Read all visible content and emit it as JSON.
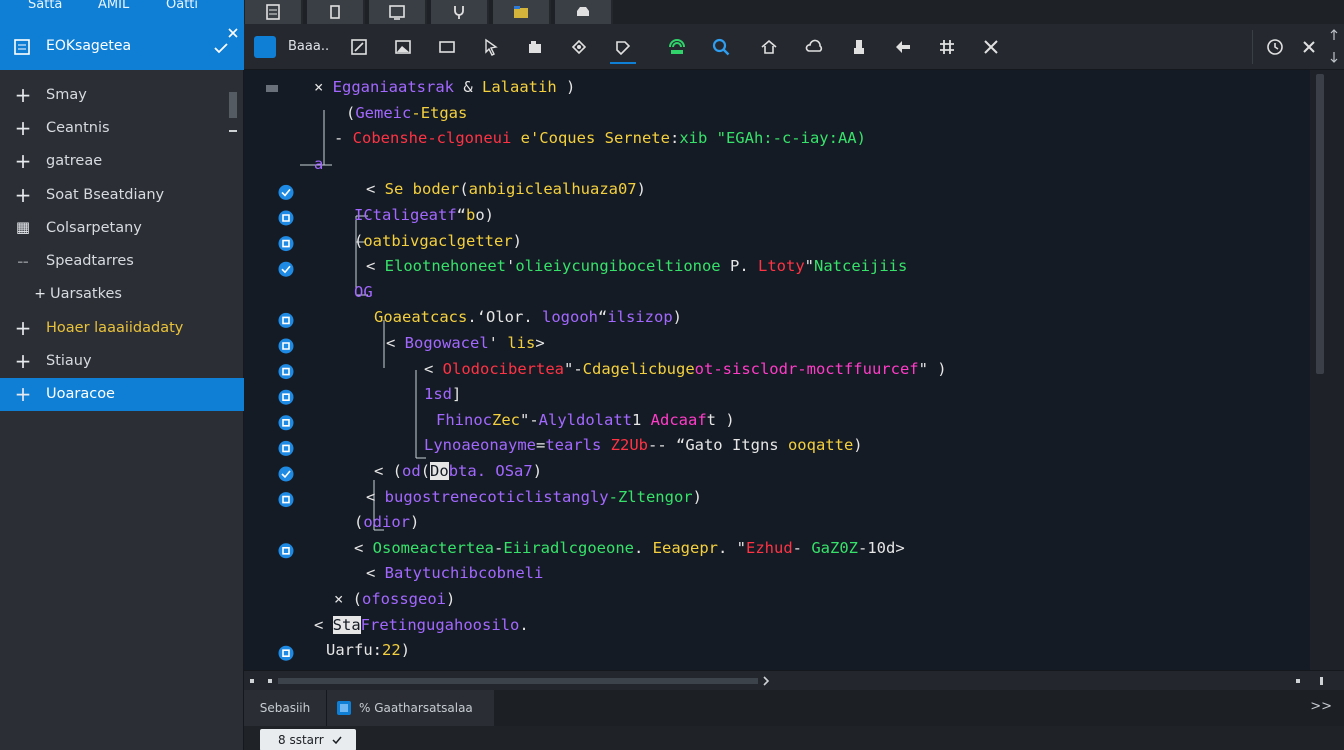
{
  "app": {
    "top_menu": [
      "Satta",
      "AMIL",
      "Oatti"
    ],
    "sidebar_title": "EOKsagetea",
    "editor_tab": "Baaa..",
    "bottom_tabs": [
      "Sebasiih",
      "% Gaatharsatsalaa"
    ],
    "bottom_status": "8 sstarr",
    "bottom_more": ">>"
  },
  "sidebar": {
    "items": [
      {
        "label": "Smay",
        "icon": "plus"
      },
      {
        "label": "Ceantnis",
        "icon": "plus"
      },
      {
        "label": "gatreae",
        "icon": "plus"
      },
      {
        "label": "Soat Bseatdiany",
        "icon": "plus"
      },
      {
        "label": "Colsarpetany",
        "icon": "grid"
      },
      {
        "label": "Speadtarres",
        "icon": "dash"
      },
      {
        "label": "Uarsatkes",
        "icon": "small-plus",
        "sub": true
      },
      {
        "label": "Hoaer laaaiidadaty",
        "icon": "plus",
        "highlight": true
      },
      {
        "label": "Stiauy",
        "icon": "plus"
      },
      {
        "label": "Uoaracoe",
        "icon": "plus",
        "active": true
      }
    ]
  },
  "colors": {
    "accent": "#0f7fd6",
    "code_bg": "#141b24",
    "purple": "#a368ff",
    "yellow": "#f4d03f",
    "red": "#ff3344",
    "green": "#37e26a",
    "magenta": "#ff3cc8",
    "white": "#e6e6e6",
    "cyan": "#36c8ff"
  },
  "code_lines": [
    {
      "marker": "",
      "guides": [],
      "indent": 0,
      "segs": [
        {
          "t": "× ",
          "c": "white"
        },
        {
          "t": "Egganiaatsrak ",
          "c": "purple"
        },
        {
          "t": "& ",
          "c": "white"
        },
        {
          "t": "Lalaatih",
          "c": "yellow"
        },
        {
          "t": " )",
          "c": "white"
        }
      ]
    },
    {
      "marker": "",
      "guides": [],
      "indent": 1,
      "segs": [
        {
          "t": "(",
          "c": "white"
        },
        {
          "t": "Gemeic",
          "c": "purple"
        },
        {
          "t": "-",
          "c": "yellow"
        },
        {
          "t": "Etgas",
          "c": "yellow"
        }
      ]
    },
    {
      "marker": "",
      "guides": [],
      "indent": 1,
      "segs": [
        {
          "t": "- ",
          "c": "white"
        },
        {
          "t": "Cobenshe-clgoneui",
          "c": "red"
        },
        {
          "t": " e'Coques ",
          "c": "yellow"
        },
        {
          "t": "Sernete",
          "c": "yellow"
        },
        {
          "t": ":",
          "c": "white"
        },
        {
          "t": "xib ",
          "c": "green"
        },
        {
          "t": "\"EGAh:-c-iay:AA)",
          "c": "green"
        }
      ]
    },
    {
      "marker": "",
      "guides": [],
      "indent": 0,
      "segs": [
        {
          "t": "  ",
          "c": "white"
        },
        {
          "t": "a",
          "c": "purple"
        }
      ]
    },
    {
      "marker": "check",
      "guides": [],
      "indent": 2,
      "segs": [
        {
          "t": "< ",
          "c": "white"
        },
        {
          "t": "Se boder",
          "c": "yellow"
        },
        {
          "t": "(",
          "c": "white"
        },
        {
          "t": "anbigiclealhuaza07",
          "c": "yellow"
        },
        {
          "t": ")",
          "c": "white"
        }
      ]
    },
    {
      "marker": "dot",
      "guides": [],
      "indent": 2,
      "segs": [
        {
          "t": "ICtaligeatf",
          "c": "purple"
        },
        {
          "t": "“",
          "c": "white"
        },
        {
          "t": "b",
          "c": "yellow"
        },
        {
          "t": "o)",
          "c": "white"
        }
      ]
    },
    {
      "marker": "dot",
      "guides": [],
      "indent": 2,
      "segs": [
        {
          "t": "(",
          "c": "white"
        },
        {
          "t": "oatbivgaclgetter",
          "c": "yellow"
        },
        {
          "t": ")",
          "c": "white"
        }
      ]
    },
    {
      "marker": "check",
      "guides": [],
      "indent": 2,
      "segs": [
        {
          "t": "< ",
          "c": "white"
        },
        {
          "t": "Elootnehoneet",
          "c": "green"
        },
        {
          "t": "'",
          "c": "white"
        },
        {
          "t": "olieiycungiboceltionoe",
          "c": "green"
        },
        {
          "t": " P",
          "c": "white"
        },
        {
          "t": ". ",
          "c": "white"
        },
        {
          "t": "Ltoty",
          "c": "red"
        },
        {
          "t": "\"",
          "c": "white"
        },
        {
          "t": "Natceijiis",
          "c": "green"
        }
      ]
    },
    {
      "marker": "",
      "guides": [],
      "indent": 2,
      "segs": [
        {
          "t": "OG",
          "c": "purple"
        }
      ]
    },
    {
      "marker": "dot",
      "guides": [],
      "indent": 3,
      "segs": [
        {
          "t": "Goaeatcacs",
          "c": "yellow"
        },
        {
          "t": ".‘",
          "c": "white"
        },
        {
          "t": "Olor",
          "c": "white"
        },
        {
          "t": ". ",
          "c": "white"
        },
        {
          "t": "logooh",
          "c": "purple"
        },
        {
          "t": "“",
          "c": "white"
        },
        {
          "t": "ilsizop",
          "c": "purple"
        },
        {
          "t": ")",
          "c": "white"
        }
      ]
    },
    {
      "marker": "dot",
      "guides": [],
      "indent": 3,
      "segs": [
        {
          "t": "< ",
          "c": "white"
        },
        {
          "t": "Bogowacel",
          "c": "purple"
        },
        {
          "t": "' ",
          "c": "white"
        },
        {
          "t": "lis",
          "c": "yellow"
        },
        {
          "t": ">",
          "c": "white"
        }
      ]
    },
    {
      "marker": "dot",
      "guides": [],
      "indent": 4,
      "segs": [
        {
          "t": "< ",
          "c": "white"
        },
        {
          "t": "Olodocibertea",
          "c": "red"
        },
        {
          "t": "\"-",
          "c": "white"
        },
        {
          "t": "Cdagelicbuge",
          "c": "yellow"
        },
        {
          "t": "ot-sisclodr-moctffuurcef",
          "c": "magenta"
        },
        {
          "t": "\" )",
          "c": "white"
        }
      ]
    },
    {
      "marker": "dot",
      "guides": [],
      "indent": 4,
      "segs": [
        {
          "t": "1sd",
          "c": "purple"
        },
        {
          "t": "]",
          "c": "white"
        }
      ]
    },
    {
      "marker": "dot",
      "guides": [],
      "indent": 4,
      "segs": [
        {
          "t": "Fhinoc",
          "c": "purple"
        },
        {
          "t": "Zec",
          "c": "yellow"
        },
        {
          "t": "\"-",
          "c": "white"
        },
        {
          "t": "Alyldolatt",
          "c": "purple"
        },
        {
          "t": "1 ",
          "c": "white"
        },
        {
          "t": "Adcaaf",
          "c": "magenta"
        },
        {
          "t": "t )",
          "c": "white"
        }
      ]
    },
    {
      "marker": "dot",
      "guides": [],
      "indent": 4,
      "segs": [
        {
          "t": "Lynoaeonayme",
          "c": "purple"
        },
        {
          "t": "=",
          "c": "white"
        },
        {
          "t": "tearls ",
          "c": "purple"
        },
        {
          "t": "Z2Ub",
          "c": "red"
        },
        {
          "t": "-- “",
          "c": "white"
        },
        {
          "t": "Gato Itgns ",
          "c": "white"
        },
        {
          "t": "ooqatte",
          "c": "yellow"
        },
        {
          "t": ")",
          "c": "white"
        }
      ]
    },
    {
      "marker": "check",
      "guides": [],
      "indent": 3,
      "segs": [
        {
          "t": "< ",
          "c": "white"
        },
        {
          "t": "(",
          "c": "white"
        },
        {
          "t": "od",
          "c": "purple"
        },
        {
          "t": "(",
          "c": "white"
        },
        {
          "t": "Do",
          "c": "white",
          "box": true
        },
        {
          "t": "bta. ",
          "c": "purple"
        },
        {
          "t": "OSa7",
          "c": "purple"
        },
        {
          "t": ")",
          "c": "white"
        }
      ]
    },
    {
      "marker": "dot",
      "guides": [],
      "indent": 2,
      "segs": [
        {
          "t": "< ",
          "c": "white"
        },
        {
          "t": "bugostrenecoticlistangly",
          "c": "purple"
        },
        {
          "t": "-Zltengor",
          "c": "green"
        },
        {
          "t": ")",
          "c": "white"
        }
      ]
    },
    {
      "marker": "",
      "guides": [],
      "indent": 2,
      "segs": [
        {
          "t": "(",
          "c": "white"
        },
        {
          "t": "odior",
          "c": "purple"
        },
        {
          "t": ")",
          "c": "white"
        }
      ]
    },
    {
      "marker": "dot",
      "guides": [],
      "indent": 2,
      "segs": [
        {
          "t": "< ",
          "c": "white"
        },
        {
          "t": "Osomeactertea",
          "c": "green"
        },
        {
          "t": "-",
          "c": "white"
        },
        {
          "t": "Eiiradlcgoeone",
          "c": "green"
        },
        {
          "t": ". ",
          "c": "white"
        },
        {
          "t": "Eeagepr",
          "c": "yellow"
        },
        {
          "t": ". \"",
          "c": "white"
        },
        {
          "t": "Ezhud",
          "c": "red"
        },
        {
          "t": "- ",
          "c": "white"
        },
        {
          "t": "GaZ0Z",
          "c": "green"
        },
        {
          "t": "-10d>",
          "c": "white"
        }
      ]
    },
    {
      "marker": "",
      "guides": [],
      "indent": 2,
      "segs": [
        {
          "t": "< ",
          "c": "white"
        },
        {
          "t": "Batytuchibcobneli",
          "c": "purple"
        }
      ]
    },
    {
      "marker": "",
      "guides": [],
      "indent": 1,
      "segs": [
        {
          "t": "× ",
          "c": "white"
        },
        {
          "t": "(",
          "c": "white"
        },
        {
          "t": "ofossgeoi",
          "c": "purple"
        },
        {
          "t": ")",
          "c": "white"
        }
      ]
    },
    {
      "marker": "",
      "guides": [],
      "indent": 0,
      "segs": [
        {
          "t": "< ",
          "c": "white"
        },
        {
          "t": "Sta",
          "c": "white",
          "box": true
        },
        {
          "t": "Fretingugahoosilo",
          "c": "purple"
        },
        {
          "t": ".",
          "c": "white"
        }
      ]
    },
    {
      "marker": "dot",
      "guides": [],
      "indent": 0,
      "segs": [
        {
          "t": "Uarfu",
          "c": "white"
        },
        {
          "t": ":",
          "c": "white"
        },
        {
          "t": "22",
          "c": "yellow"
        },
        {
          "t": ")",
          "c": "white"
        }
      ]
    }
  ]
}
